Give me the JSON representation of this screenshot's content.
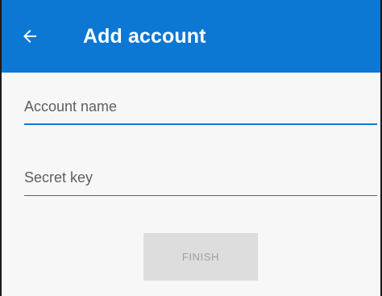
{
  "header": {
    "title": "Add account"
  },
  "form": {
    "account_name": {
      "placeholder": "Account name",
      "value": ""
    },
    "secret_key": {
      "placeholder": "Secret key",
      "value": ""
    },
    "finish_label": "FINISH"
  },
  "icons": {
    "back": "back-arrow-icon"
  },
  "colors": {
    "app_bar": "#0d78d3",
    "accent": "#1a78c9",
    "background": "#f7f7f7",
    "button_disabled": "#dddddd",
    "button_text_disabled": "#9f9f9f"
  }
}
